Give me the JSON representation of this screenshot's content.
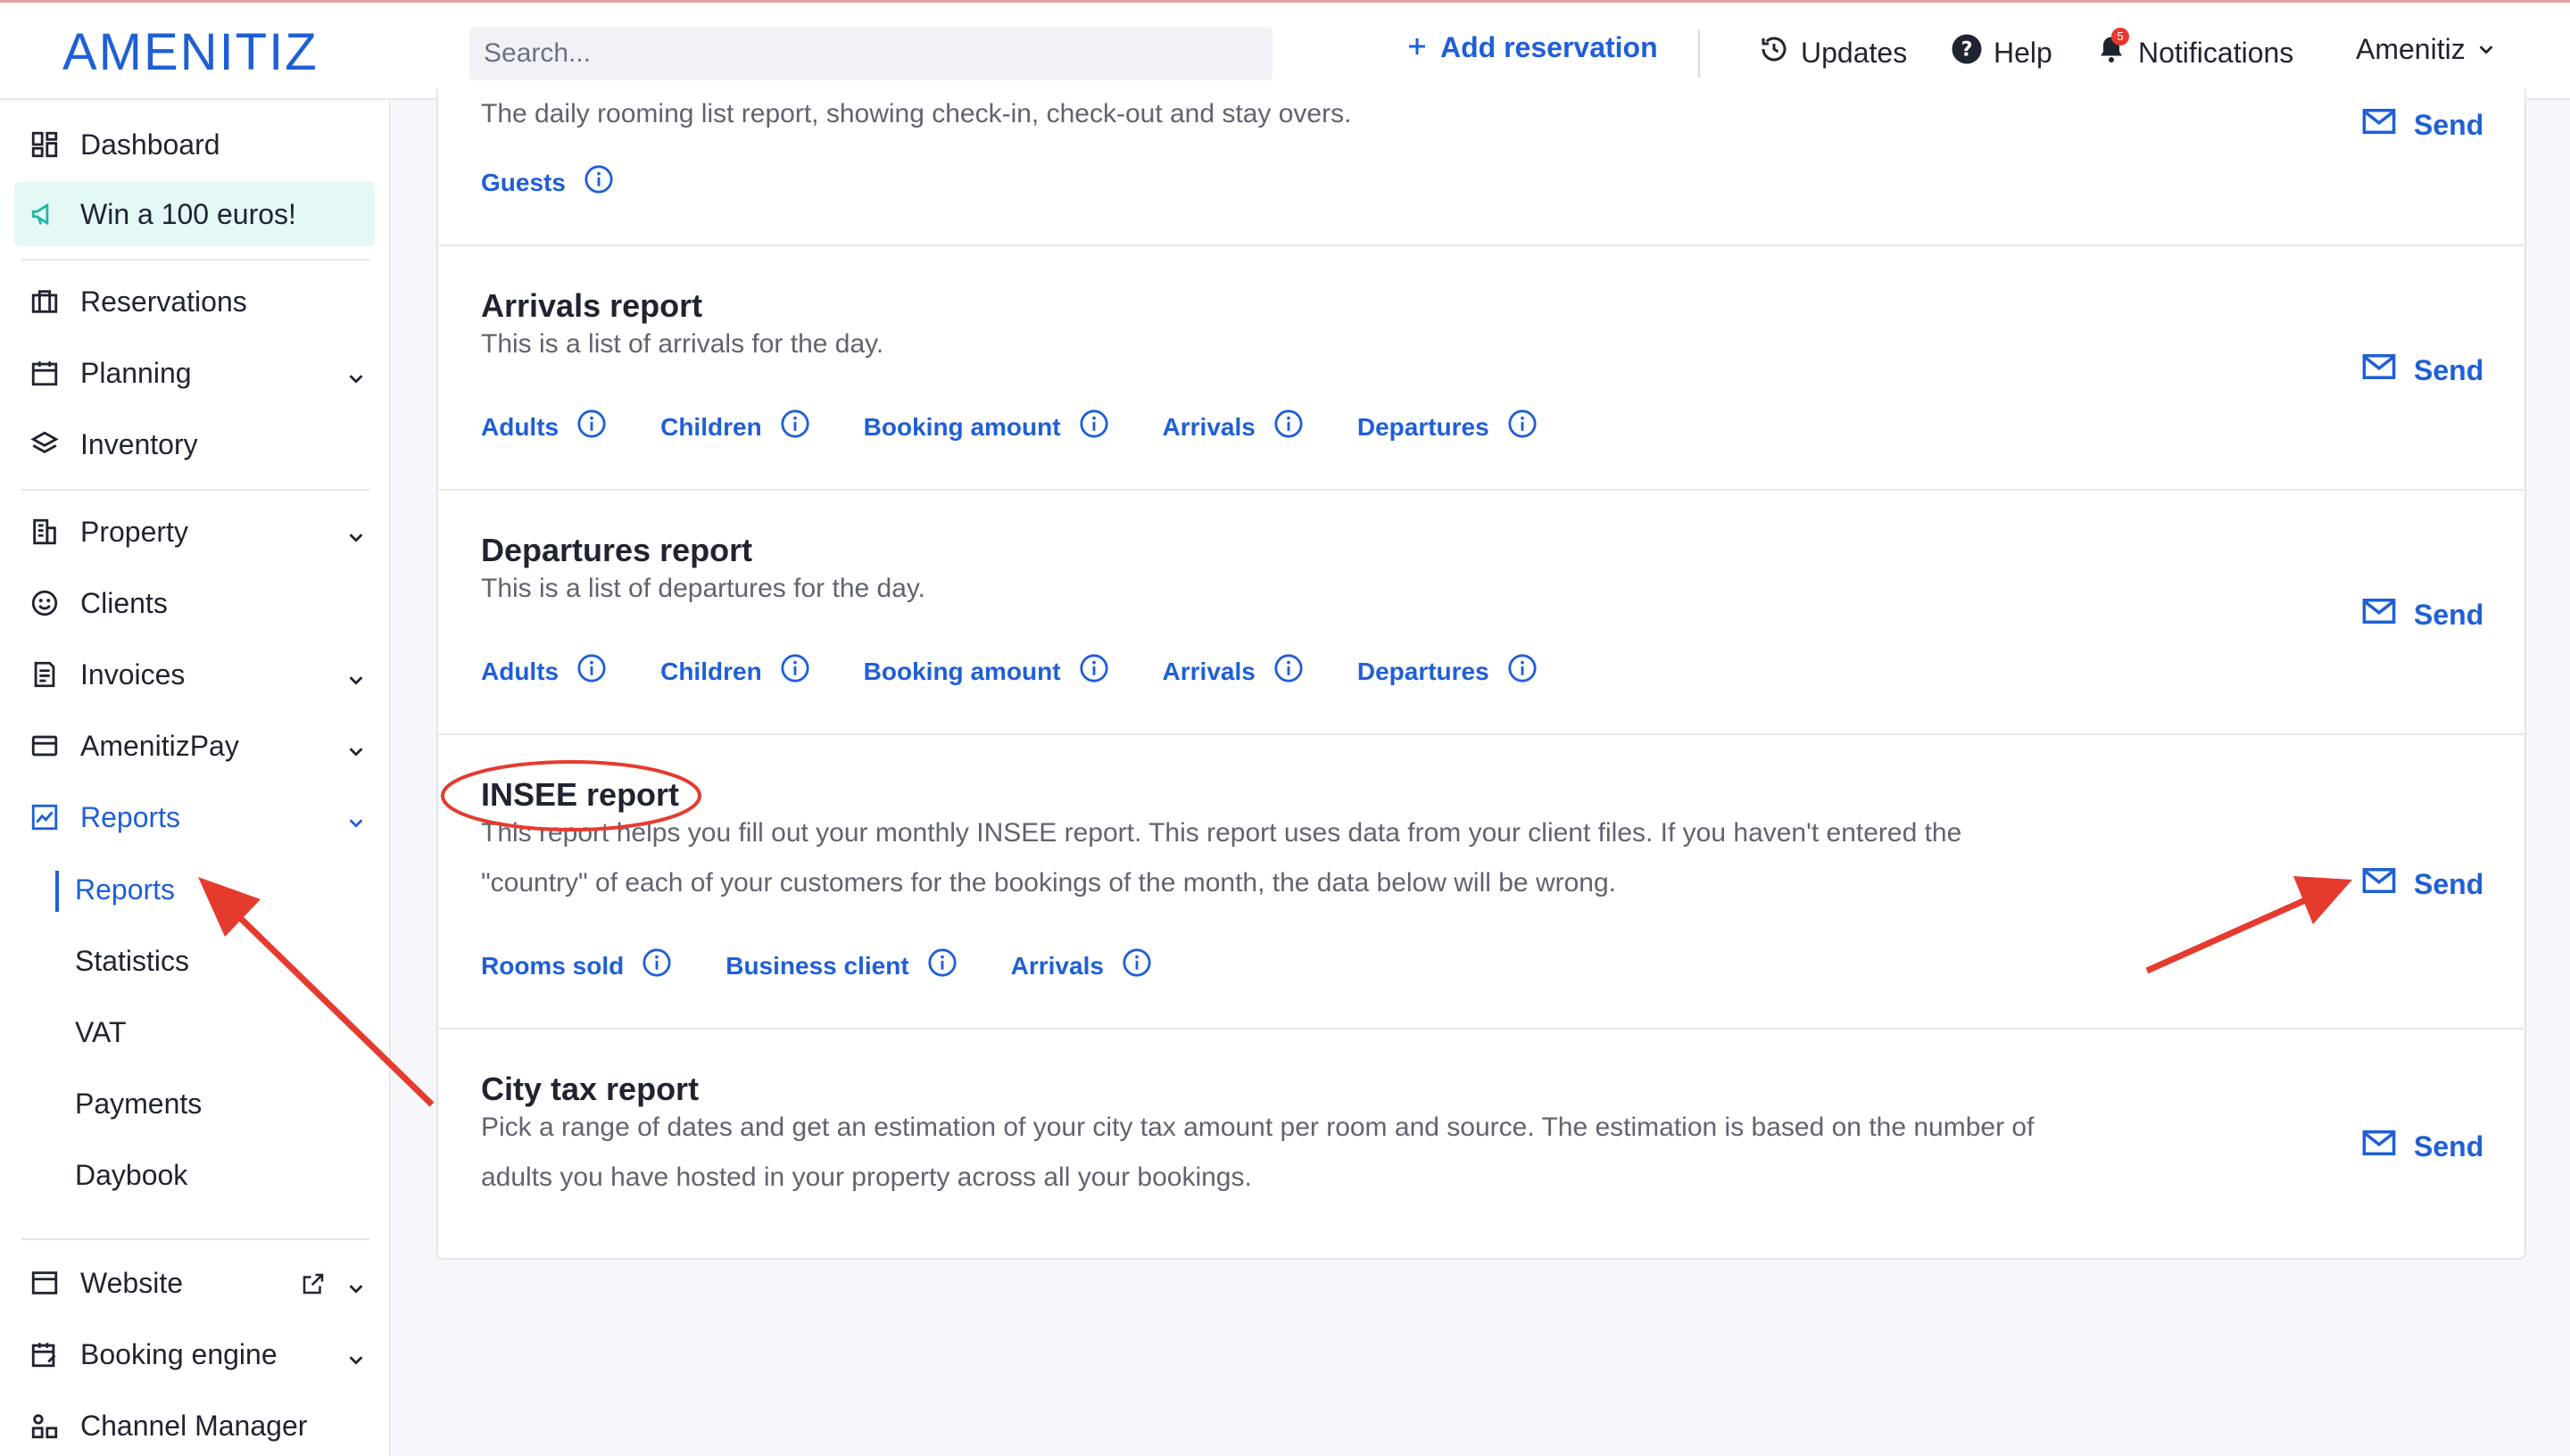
{
  "header": {
    "logo": "AMENITIZ",
    "search_placeholder": "Search...",
    "add_reservation": "Add reservation",
    "updates": "Updates",
    "help": "Help",
    "notifications": "Notifications",
    "notifications_count": "5",
    "account": "Amenitiz"
  },
  "sidebar": {
    "dashboard": "Dashboard",
    "promo": "Win a 100 euros!",
    "reservations": "Reservations",
    "planning": "Planning",
    "inventory": "Inventory",
    "property": "Property",
    "clients": "Clients",
    "invoices": "Invoices",
    "amenitizpay": "AmenitizPay",
    "reports": "Reports",
    "reports_sub": [
      "Reports",
      "Statistics",
      "VAT",
      "Payments",
      "Daybook"
    ],
    "website": "Website",
    "booking_engine": "Booking engine",
    "channel_manager": "Channel Manager"
  },
  "reports": [
    {
      "title": "",
      "description": "The daily rooming list report, showing check-in, check-out and stay overs.",
      "tags": [
        "Guests"
      ],
      "send": "Send"
    },
    {
      "title": "Arrivals report",
      "description": "This is a list of arrivals for the day.",
      "tags": [
        "Adults",
        "Children",
        "Booking amount",
        "Arrivals",
        "Departures"
      ],
      "send": "Send"
    },
    {
      "title": "Departures report",
      "description": "This is a list of departures for the day.",
      "tags": [
        "Adults",
        "Children",
        "Booking amount",
        "Arrivals",
        "Departures"
      ],
      "send": "Send"
    },
    {
      "title": "INSEE report",
      "description_1": "This report helps you fill out your monthly INSEE report. This report uses data from your client files. If you haven't entered the",
      "description_2": "\"country\" of each of your customers for the bookings of the month, the data below will be wrong.",
      "tags": [
        "Rooms sold",
        "Business client",
        "Arrivals"
      ],
      "send": "Send"
    },
    {
      "title": "City tax report",
      "description_1": "Pick a range of dates and get an estimation of your city tax amount per room and source. The estimation is based on the number of",
      "description_2": "adults you have hosted in your property across all your bookings.",
      "send": "Send"
    }
  ],
  "colors": {
    "accent": "#1f5fd6",
    "annotation": "#e53b2f",
    "promo_bg": "#e4f8f5"
  }
}
